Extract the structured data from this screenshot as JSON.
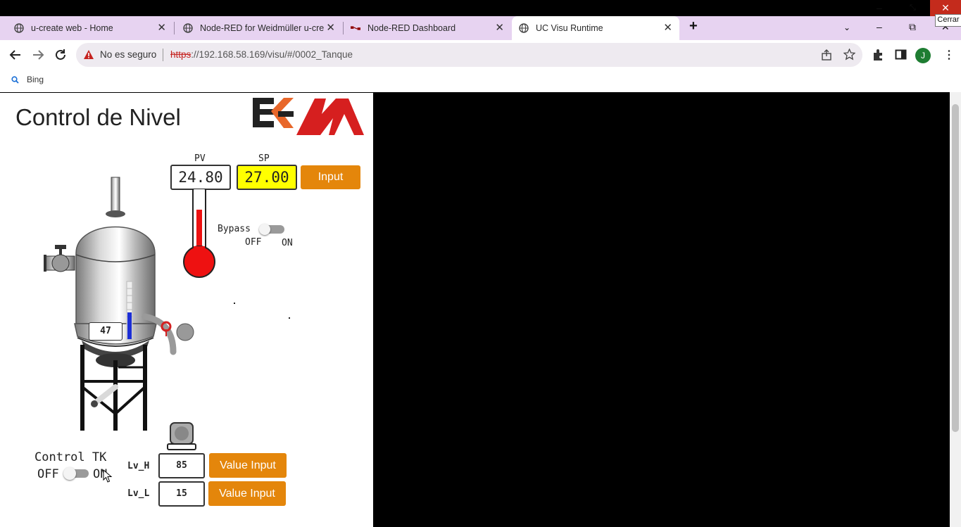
{
  "browser": {
    "tabs": [
      {
        "title": "u-create web - Home"
      },
      {
        "title": "Node-RED for Weidmüller u-crea"
      },
      {
        "title": "Node-RED Dashboard"
      },
      {
        "title": "UC Visu Runtime"
      }
    ],
    "new_tab_label": "+",
    "close_tooltip": "Cerrar",
    "address": {
      "security_label": "No es seguro",
      "url_scheme": "https",
      "url_rest": "://192.168.58.169/visu/#/0002_Tanque"
    },
    "profile_initial": "J",
    "bookmarks": [
      {
        "label": "Bing"
      }
    ]
  },
  "scada": {
    "title": "Control de Nivel",
    "pv_label": "PV",
    "pv_value": "24.80",
    "sp_label": "SP",
    "sp_value": "27.00",
    "input_button": "Input",
    "bypass_label": "Bypass",
    "bypass_off": "OFF",
    "bypass_on": "ON",
    "tank_level": "47",
    "tank_level_fraction": 0.47,
    "thermometer_fill_fraction": 0.72,
    "control_label": "Control TK",
    "control_off": "OFF",
    "control_on": "ON",
    "lv_h_label": "Lv_H",
    "lv_h_value": "85",
    "lv_l_label": "Lv_L",
    "lv_l_value": "15",
    "value_input_button": "Value Input",
    "colors": {
      "accent_orange": "#e4860b",
      "sp_yellow": "#ffff00",
      "thermo_red": "#ee1111",
      "level_blue": "#1c2ed6"
    }
  }
}
